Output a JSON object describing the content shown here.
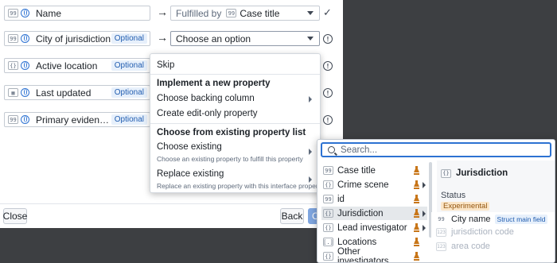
{
  "rows": [
    {
      "label": "Name",
      "icon": "99",
      "optional": "",
      "target": "Case title",
      "fulfilled_prefix": "Fulfilled by",
      "target_icon": "99"
    },
    {
      "label": "City of jurisdiction",
      "icon": "99",
      "optional": "Optional",
      "target": "Choose an option"
    },
    {
      "label": "Active location",
      "icon": "{}",
      "optional": "Optional"
    },
    {
      "label": "Last updated",
      "icon": "▦",
      "optional": "Optional"
    },
    {
      "label": "Primary evidence summ...",
      "icon": "99",
      "optional": "Optional"
    }
  ],
  "footer": {
    "close": "Close",
    "back": "Back",
    "continue": "Co"
  },
  "menu": {
    "skip": "Skip",
    "section1": "Implement a new property",
    "choose_backing": "Choose backing column",
    "create_edit_only": "Create edit-only property",
    "section2": "Choose from existing property list",
    "choose_existing": "Choose existing",
    "choose_existing_sub": "Choose an existing property to fulfill this property",
    "replace_existing": "Replace existing",
    "replace_existing_sub": "Replace an existing property with this interface property"
  },
  "popover": {
    "search_placeholder": "Search...",
    "items": [
      {
        "icon": "99",
        "label": "Case title"
      },
      {
        "icon": "{}",
        "label": "Crime scene"
      },
      {
        "icon": "99",
        "label": "id"
      },
      {
        "icon": "{}",
        "label": "Jurisdiction"
      },
      {
        "icon": "{}",
        "label": "Lead investigator"
      },
      {
        "icon": "[.]",
        "label": "Locations"
      },
      {
        "icon": "{}",
        "label": "Other investigators"
      }
    ],
    "detail_title": "Jurisdiction",
    "detail_icon": "{}",
    "status_label": "Status",
    "status_value": "Experimental",
    "struct_fields": [
      {
        "icon": "99",
        "label": "City name",
        "badge": "Struct main field"
      },
      {
        "icon": "123",
        "label": "jurisdiction code"
      },
      {
        "icon": "123",
        "label": "area code"
      }
    ]
  },
  "colors": {
    "accent": "#2d72d2",
    "warning": "#c87619",
    "optional_bg": "#e7f0fb"
  }
}
